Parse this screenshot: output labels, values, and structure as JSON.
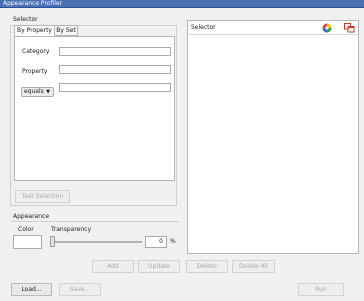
{
  "window": {
    "title": "Appearance Profiler"
  },
  "selector_group": {
    "label": "Selector",
    "tabs": [
      {
        "label": "By Property",
        "active": true
      },
      {
        "label": "By Set",
        "active": false
      }
    ],
    "fields": {
      "category_label": "Category",
      "category_value": "",
      "property_label": "Property",
      "property_value": "",
      "operator_value": "equals",
      "operator_arrow": "▼",
      "condition_value": ""
    },
    "test_selection_label": "Test Selection"
  },
  "appearance": {
    "label": "Appearance",
    "color_label": "Color",
    "transparency_label": "Transparency",
    "transparency_value": "0",
    "transparency_unit": "%",
    "transparency_level": 0
  },
  "actions": {
    "add": "Add",
    "update": "Update",
    "delete": "Delete",
    "delete_all": "Delete All",
    "load": "Load...",
    "save": "Save...",
    "run": "Run"
  },
  "right_panel": {
    "header_label": "Selector",
    "icons": [
      "color-wheel-icon",
      "copy-windows-icon"
    ]
  },
  "colors": {
    "titlebar": "#4a6fb3",
    "window_bg": "#f0f0f0"
  }
}
